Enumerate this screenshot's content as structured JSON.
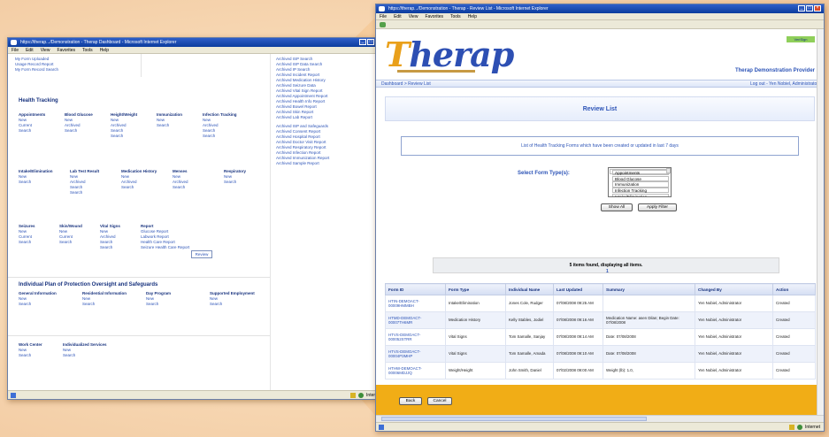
{
  "back_window": {
    "title": "https://therap.../Demonstration - Therap Dashboard - Microsoft Internet Explorer",
    "menu": [
      "File",
      "Edit",
      "View",
      "Favorites",
      "Tools",
      "Help"
    ],
    "top_links": [
      "My Form Uploaded",
      "Usage Record Report",
      "My Form Record Search"
    ],
    "right_links": [
      "Archived ISP Search",
      "Archived ISP Data Search",
      "Archived IP Search",
      "Archived Incident Report",
      "Archived Medication History",
      "Archived Seizure Data",
      "Archived Vital Sign Report",
      "Archived Appointment Report",
      "Archived Health Info Report",
      "Archived Bowel Report",
      "Archived Skin Report",
      "Archived Lab Report",
      "Archived ISP and Safeguards",
      "Archived Consent Report",
      "Archived Hospital Report",
      "Archived Doctor Visit Report",
      "Archived Respiratory Report",
      "Archived Infection Report",
      "Archived Immunization Report",
      "Archived Sample Report"
    ],
    "health_tracking_title": "Health Tracking",
    "ht_row1": [
      {
        "head": "Appointments",
        "items": [
          "New",
          "Current",
          "Search"
        ]
      },
      {
        "head": "Blood Glucose",
        "items": [
          "New",
          "Archived",
          "Search"
        ]
      },
      {
        "head": "Height/Weight",
        "items": [
          "New",
          "Archived",
          "Search",
          "Search"
        ]
      },
      {
        "head": "Immunization",
        "items": [
          "New",
          "Search"
        ]
      },
      {
        "head": "Infection Tracking",
        "items": [
          "New",
          "Archived",
          "Search",
          "Search"
        ]
      }
    ],
    "ht_row2": [
      {
        "head": "Intake/Elimination",
        "items": [
          "New",
          "Search"
        ]
      },
      {
        "head": "Lab Test Result",
        "items": [
          "New",
          "Archived",
          "Search",
          "Search"
        ]
      },
      {
        "head": "Medication History",
        "items": [
          "New",
          "Archived",
          "Search"
        ]
      },
      {
        "head": "Menses",
        "items": [
          "New",
          "Archived",
          "Search"
        ]
      },
      {
        "head": "Respiratory",
        "items": [
          "New",
          "Search"
        ]
      }
    ],
    "ht_row3": [
      {
        "head": "Seizures",
        "items": [
          "New",
          "Current",
          "Search"
        ]
      },
      {
        "head": "Skin/Wound",
        "items": [
          "New",
          "Current",
          "Search"
        ]
      },
      {
        "head": "Vital Signs",
        "items": [
          "New",
          "Archived",
          "Search",
          "Search"
        ]
      },
      {
        "head": "Report",
        "items": [
          "Glucose Report",
          "Labwork Report",
          "Health Care Report",
          "Seizure Health Care Report"
        ]
      }
    ],
    "review_box": "Review",
    "ipop_title": "Individual Plan of Protection Oversight and Safeguards",
    "ipop_cols": [
      {
        "head": "General Information",
        "items": [
          "New",
          "Search"
        ]
      },
      {
        "head": "Residential Information",
        "items": [
          "New",
          "Search"
        ]
      },
      {
        "head": "Day Program",
        "items": [
          "New",
          "Search"
        ]
      },
      {
        "head": "Supported Employment",
        "items": [
          "New",
          "Search"
        ]
      }
    ],
    "bottom_cols": [
      {
        "head": "Work Center",
        "items": [
          "New",
          "Search"
        ]
      },
      {
        "head": "Individualized Services",
        "items": [
          "New",
          "Search"
        ]
      }
    ],
    "status_zone": "Internet"
  },
  "front_window": {
    "title": "https://therap.../Demonstration - Therap - Review List - Microsoft Internet Explorer",
    "menu": [
      "File",
      "Edit",
      "View",
      "Favorites",
      "Tools",
      "Help"
    ],
    "logo_prefix": "T",
    "logo_rest": "herap",
    "badge": "VeriSign",
    "provider": "Therap Demonstration Provider",
    "breadcrumb": "Dashboard > Review List",
    "logout": "Log out - Yen Nobiel, Administrator",
    "review_title": "Review List",
    "info_text": "List of Health Tracking Forms which have been created or updated in last 7 days",
    "select_label": "Select Form Type(s):",
    "form_types": [
      "Appointments",
      "Blood Glucose",
      "Immunization",
      "Infection Tracking",
      "Intake/Elimination"
    ],
    "show_all": "Show All",
    "apply_filter": "Apply Filter",
    "found_text": "5 items found, displaying all items.",
    "page_number": "1",
    "columns": [
      "Form ID",
      "Form Type",
      "Individual Name",
      "Last Updated",
      "Summary",
      "Changed By",
      "Action"
    ],
    "rows": [
      {
        "id": "HTIN-DEMOACT-00009HMMBH",
        "type": "Intake/Elimination",
        "name": "Jones Cole, Rudger",
        "updated": "07/08/2008 09:25 AM",
        "summary": "",
        "by": "Yen Nobiel, Administrator",
        "action": "Created"
      },
      {
        "id": "HTMD-DEMOACT-00007TH6MR",
        "type": "Medication History",
        "name": "Kelly Stables, Jodiel",
        "updated": "07/08/2008 09:16 AM",
        "summary": "Medication Name: asen Dilan; Begin Date: 07/08/2008",
        "by": "Yen Nobiel, Administrator",
        "action": "Created"
      },
      {
        "id": "HTVS-DEMOACT-000052STRR",
        "type": "Vital Signs",
        "name": "Tom Samalle, Sanjay",
        "updated": "07/08/2008 09:14 AM",
        "summary": "Date: 07/08/2008",
        "by": "Yen Nobiel, Administrator",
        "action": "Created"
      },
      {
        "id": "HTVS-DEMOACT-00004P3MHP",
        "type": "Vital Signs",
        "name": "Tom Samalle, Amada",
        "updated": "07/08/2008 09:10 AM",
        "summary": "Date: 07/08/2008",
        "by": "Yen Nobiel, Administrator",
        "action": "Created"
      },
      {
        "id": "HTHW-DEMOACT-00006MDJJQ",
        "type": "Weight/Height",
        "name": "John Smith, Daniel",
        "updated": "07/02/2008 09:00 AM",
        "summary": "Weight (lb): 1.0,",
        "by": "Yen Nobiel, Administrator",
        "action": "Created"
      }
    ],
    "back_btn": "Back",
    "cancel_btn": "Cancel",
    "status_zone": "Internet"
  }
}
